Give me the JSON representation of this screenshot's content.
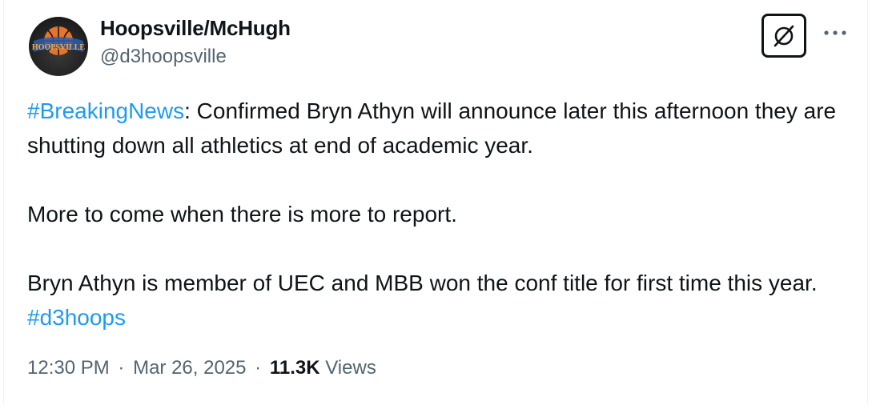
{
  "author": {
    "display_name": "Hoopsville/McHugh",
    "handle": "@d3hoopsville",
    "avatar_text": "HOOPSVILLE",
    "avatar_icon": "basketball-logo"
  },
  "actions": {
    "grok_icon": "slashed-circle-icon",
    "more_icon": "ellipsis-icon"
  },
  "tweet": {
    "hashtag_breaking": "#BreakingNews",
    "line1_rest": ": Confirmed Bryn Athyn will announce later this afternoon they are shutting down all athletics at end of academic year.",
    "line2": "More to come when there is more to report.",
    "line3_text": "Bryn Athyn is member of UEC and MBB won the conf title for first time this year. ",
    "hashtag_d3hoops": "#d3hoops"
  },
  "meta": {
    "time": "12:30 PM",
    "separator": "·",
    "date": "Mar 26, 2025",
    "views_count": "11.3K",
    "views_label": "Views"
  },
  "colors": {
    "link": "#1d9bf0",
    "text": "#0f1419",
    "muted": "#536471"
  }
}
